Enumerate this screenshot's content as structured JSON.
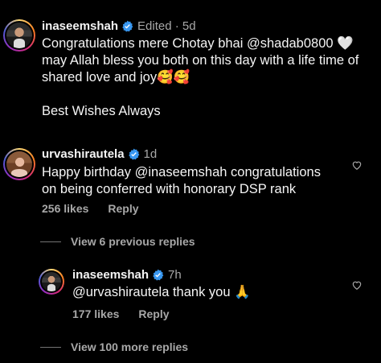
{
  "comments": [
    {
      "username": "inaseemshah",
      "meta": "Edited · 5d",
      "text": "Congratulations mere Chotay bhai @shadab0800 🤍\nmay Allah bless you both on this day with a life time of\nshared love and joy🥰🥰\n\nBest Wishes Always",
      "avatar_icon": "profile-photo-man"
    },
    {
      "username": "urvashirautela",
      "meta": "1d",
      "text": "Happy birthday @inaseemshah congratulations\non being conferred with honorary DSP rank",
      "likes": "256 likes",
      "reply": "Reply",
      "avatar_icon": "profile-photo-woman"
    }
  ],
  "view_previous": "View 6 previous replies",
  "reply": {
    "username": "inaseemshah",
    "meta": "7h",
    "text": "@urvashirautela thank you 🙏",
    "likes": "177 likes",
    "reply": "Reply",
    "avatar_icon": "profile-photo-man"
  },
  "view_more": "View 100 more replies",
  "colors": {
    "verified": "#3897f0",
    "muted": "#a8a8a8",
    "background": "#000000"
  },
  "icons": {
    "verified": "verified-badge-icon",
    "like": "heart-outline-icon"
  }
}
